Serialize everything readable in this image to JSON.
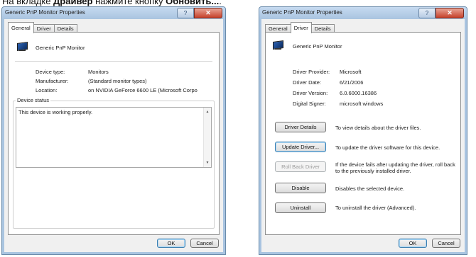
{
  "caption": {
    "text1": "На вкладке ",
    "bold1": "Драйвер",
    "text2": " нажмите кнопку ",
    "bold2": "Обновить...",
    "text3": "."
  },
  "window_general": {
    "title": "Generic PnP Monitor Properties",
    "help_glyph": "?",
    "close_glyph": "✕",
    "tabs": [
      "General",
      "Driver",
      "Details"
    ],
    "active_tab": "General",
    "device_name": "Generic PnP Monitor",
    "props": [
      {
        "label": "Device type:",
        "value": "Monitors"
      },
      {
        "label": "Manufacturer:",
        "value": "(Standard monitor types)"
      },
      {
        "label": "Location:",
        "value": "on NVIDIA GeForce 6600 LE (Microsoft Corpo"
      }
    ],
    "status_group_title": "Device status",
    "status_text": "This device is working properly.",
    "ok": "OK",
    "cancel": "Cancel"
  },
  "window_driver": {
    "title": "Generic PnP Monitor Properties",
    "help_glyph": "?",
    "close_glyph": "✕",
    "tabs": [
      "General",
      "Driver",
      "Details"
    ],
    "active_tab": "Driver",
    "device_name": "Generic PnP Monitor",
    "props": [
      {
        "label": "Driver Provider:",
        "value": "Microsoft"
      },
      {
        "label": "Driver Date:",
        "value": "6/21/2006"
      },
      {
        "label": "Driver Version:",
        "value": "6.0.6000.16386"
      },
      {
        "label": "Digital Signer:",
        "value": "microsoft windows"
      }
    ],
    "actions": [
      {
        "button": "Driver Details",
        "desc": "To view details about the driver files."
      },
      {
        "button": "Update Driver...",
        "desc": "To update the driver software for this device."
      },
      {
        "button": "Roll Back Driver",
        "desc": "If the device fails after updating the driver, roll back to the previously installed driver."
      },
      {
        "button": "Disable",
        "desc": "Disables the selected device."
      },
      {
        "button": "Uninstall",
        "desc": "To uninstall the driver (Advanced)."
      }
    ],
    "ok": "OK",
    "cancel": "Cancel"
  }
}
